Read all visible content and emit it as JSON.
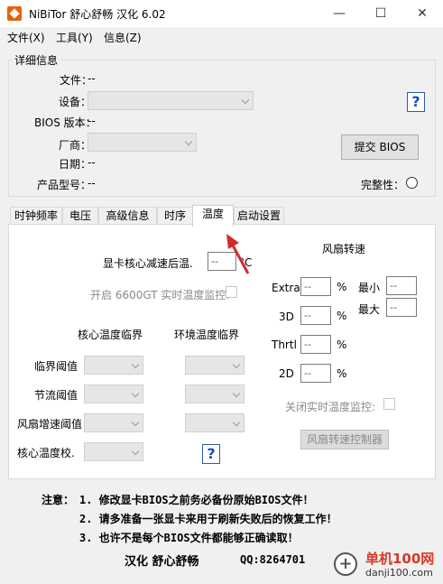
{
  "window": {
    "title": "NiBiTor 舒心舒畅 汉化 6.02",
    "minimize": "—",
    "maximize": "☐",
    "close": "✕"
  },
  "menu": [
    "文件(X)",
    "工具(Y)",
    "信息(Z)"
  ],
  "details": {
    "group_title": "详细信息",
    "file_label": "文件：",
    "file_value": "--",
    "device_label": "设备：",
    "bios_label": "BIOS 版本：",
    "bios_value": "--",
    "vendor_label": "厂商：",
    "date_label": "日期：",
    "date_value": "--",
    "model_label": "产品型号：",
    "model_value": "--",
    "submit_button": "提交 BIOS",
    "integrity_label": "完整性：",
    "help": "?"
  },
  "tabs": [
    "时钟频率",
    "电压",
    "高级信息",
    "时序",
    "温度",
    "启动设置"
  ],
  "active_tab": "温度",
  "temp": {
    "core_reduce_label": "显卡核心减速后温.",
    "core_reduce_value": "--",
    "core_reduce_unit": "°C",
    "enable_6600gt_label": "开启 6600GT 实时温度监控:",
    "core_critical_header": "核心温度临界",
    "env_critical_header": "环境温度临界",
    "rows": [
      "临界阈值",
      "节流阈值",
      "风扇增速阈值",
      "核心温度校."
    ],
    "help": "?"
  },
  "fan": {
    "header": "风扇转速",
    "extra_label": "Extra",
    "extra_value": "--",
    "unit": "%",
    "l3d_label": "3D",
    "l3d_value": "--",
    "thrtl_label": "Thrtl",
    "thrtl_value": "--",
    "l2d_label": "2D",
    "l2d_value": "--",
    "min_label": "最小",
    "min_value": "--",
    "max_label": "最大",
    "max_value": "--",
    "disable_monitor_label": "关闭实时温度监控:",
    "controller_button": "风扇转速控制器"
  },
  "notes": {
    "prefix": "注意：",
    "line1": "1. 修改显卡BIOS之前务必备份原始BIOS文件！",
    "line2": "2. 请多准备一张显卡来用于刷新失败后的恢复工作！",
    "line3": "3. 也许不是每个BIOS文件都能够正确读取！",
    "credit": "汉化  舒心舒畅",
    "qq": "QQ:8264701"
  },
  "watermark": {
    "cn": "单机100网",
    "url": "danji100.com"
  }
}
